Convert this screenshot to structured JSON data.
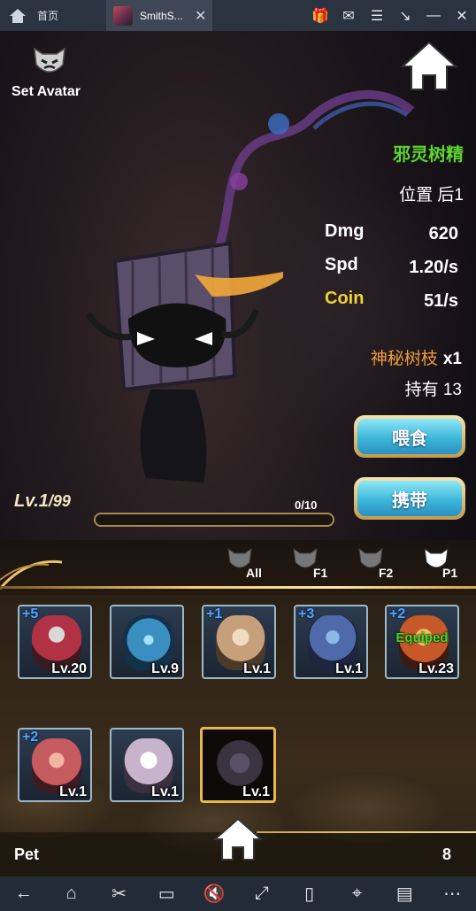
{
  "tabs": {
    "home_label": "首页",
    "game_label": "SmithS...",
    "close_glyph": "✕"
  },
  "system_icons": [
    "gift-icon",
    "mail-icon",
    "menu-icon",
    "collapse-icon",
    "minimize-icon",
    "close-icon"
  ],
  "header": {
    "set_avatar": "Set Avatar"
  },
  "pet": {
    "name": "邪灵树精",
    "position_label": "位置",
    "position_value": "后1",
    "stats": [
      {
        "label": "Dmg",
        "value": "620",
        "color": "#ffffff"
      },
      {
        "label": "Spd",
        "value": "1.20/s",
        "color": "#ffffff"
      },
      {
        "label": "Coin",
        "value": "51/s",
        "color": "#f4d12f"
      }
    ],
    "level": "Lv.1",
    "max_level": "/99",
    "exp_text": "0/10",
    "exp_fraction": 0
  },
  "food": {
    "item_name": "神秘树枝",
    "item_qty": "x1",
    "owned_label": "持有",
    "owned_value": "13"
  },
  "buttons": {
    "feed": "喂食",
    "carry": "携带"
  },
  "filters": [
    {
      "label": "All",
      "selected": false
    },
    {
      "label": "F1",
      "selected": false
    },
    {
      "label": "F2",
      "selected": false
    },
    {
      "label": "P1",
      "selected": true
    }
  ],
  "pets": [
    {
      "plus": "+5",
      "level": "Lv.20",
      "equipped": "",
      "color": "#b23245"
    },
    {
      "plus": "",
      "level": "Lv.9",
      "equipped": "",
      "color": "#3b8fc0"
    },
    {
      "plus": "+1",
      "level": "Lv.1",
      "equipped": "",
      "color": "#c6a07a"
    },
    {
      "plus": "+3",
      "level": "Lv.1",
      "equipped": "",
      "color": "#4e6aa8"
    },
    {
      "plus": "+2",
      "level": "Lv.23",
      "equipped": "Equiped",
      "color": "#c7582a"
    },
    {
      "plus": "+2",
      "level": "Lv.1",
      "equipped": "",
      "color": "#c55a5f"
    },
    {
      "plus": "",
      "level": "Lv.1",
      "equipped": "",
      "color": "#c8b3cc"
    },
    {
      "plus": "",
      "level": "Lv.1",
      "equipped": "",
      "color": "#3a3340",
      "selected": true
    }
  ],
  "footer": {
    "pet_label": "Pet",
    "pet_count": "8"
  },
  "navbar_icons": [
    "back-icon",
    "home-icon",
    "scissors-icon",
    "folder-icon",
    "mute-icon",
    "fullscreen-icon",
    "rotate-icon",
    "location-icon",
    "apk-icon",
    "more-icon"
  ]
}
